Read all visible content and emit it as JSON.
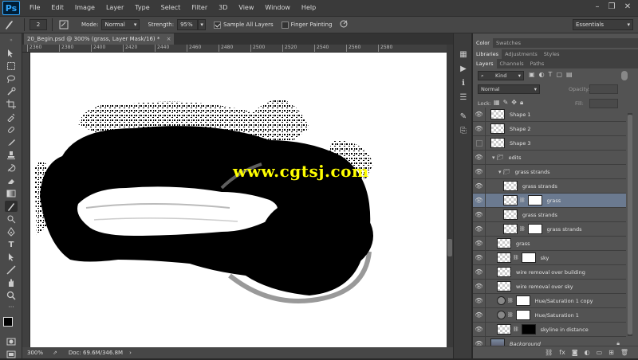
{
  "app": {
    "logo": "Ps"
  },
  "menu": [
    "File",
    "Edit",
    "Image",
    "Layer",
    "Type",
    "Select",
    "Filter",
    "3D",
    "View",
    "Window",
    "Help"
  ],
  "options": {
    "brush_size": "2",
    "mode_label": "Mode:",
    "mode_value": "Normal",
    "strength_label": "Strength:",
    "strength_value": "95%",
    "sample_all_layers": "Sample All Layers",
    "finger_painting": "Finger Painting",
    "workspace": "Essentials"
  },
  "document": {
    "tab_title": "20_Begin.psd @ 300% (grass, Layer Mask/16) *",
    "ruler_ticks": [
      "2360",
      "2380",
      "2400",
      "2420",
      "2440",
      "2460",
      "2480",
      "2500",
      "2520",
      "2540",
      "2560",
      "2580"
    ],
    "zoom": "300%",
    "doc_info": "Doc: 69.6M/346.8M"
  },
  "watermark": "www.cgtsj.com",
  "panels": {
    "top_tabs": [
      "Color",
      "Swatches"
    ],
    "mid_tabs": [
      "Libraries",
      "Adjustments",
      "Styles"
    ],
    "layer_tabs": [
      "Layers",
      "Channels",
      "Paths"
    ],
    "kind_label": "Kind",
    "blend_mode": "Normal",
    "opacity_label": "Opacity:",
    "lock_label": "Lock:",
    "fill_label": "Fill:"
  },
  "layers": [
    {
      "name": "Shape 1",
      "indent": 0,
      "type": "shape",
      "visible": true
    },
    {
      "name": "Shape 2",
      "indent": 0,
      "type": "shape",
      "visible": true
    },
    {
      "name": "Shape 3",
      "indent": 0,
      "type": "shape",
      "visible": false
    },
    {
      "name": "edits",
      "indent": 0,
      "type": "group",
      "visible": true
    },
    {
      "name": "grass strands",
      "indent": 1,
      "type": "group",
      "visible": true
    },
    {
      "name": "grass strands",
      "indent": 2,
      "type": "pixel",
      "visible": true
    },
    {
      "name": "grass",
      "indent": 2,
      "type": "masked",
      "visible": true,
      "selected": true
    },
    {
      "name": "grass strands",
      "indent": 2,
      "type": "pixel",
      "visible": true
    },
    {
      "name": "grass strands",
      "indent": 2,
      "type": "masked",
      "visible": true
    },
    {
      "name": "grass",
      "indent": 1,
      "type": "pixel",
      "visible": true
    },
    {
      "name": "sky",
      "indent": 1,
      "type": "masked",
      "visible": true
    },
    {
      "name": "wire removal over building",
      "indent": 1,
      "type": "pixel",
      "visible": true
    },
    {
      "name": "wire removal over sky",
      "indent": 1,
      "type": "pixel",
      "visible": true
    },
    {
      "name": "Hue/Saturation 1 copy",
      "indent": 1,
      "type": "adjust",
      "visible": true
    },
    {
      "name": "Hue/Saturation 1",
      "indent": 1,
      "type": "adjust",
      "visible": true
    },
    {
      "name": "skyline in distance",
      "indent": 1,
      "type": "masked",
      "visible": true
    },
    {
      "name": "Background",
      "indent": 0,
      "type": "bg",
      "visible": true
    }
  ]
}
